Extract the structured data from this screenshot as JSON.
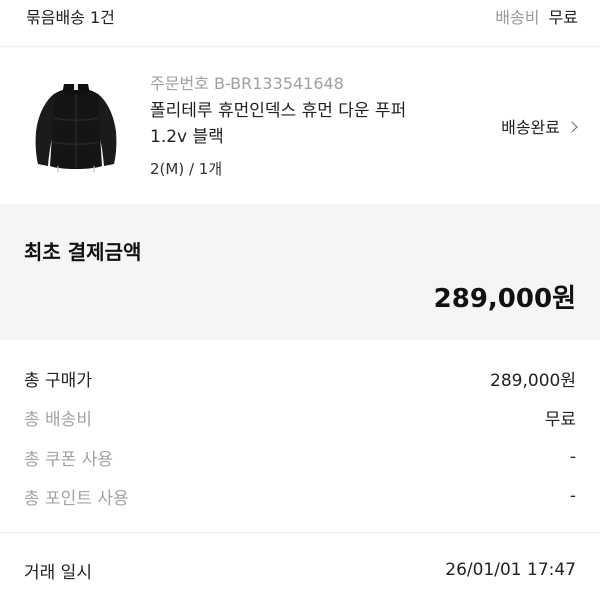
{
  "bundle": {
    "title": "묶음배송 1건",
    "shipping_fee_label": "배송비",
    "shipping_fee_value": "무료"
  },
  "product": {
    "order_number": "주문번호 B-BR133541648",
    "name": "폴리테루 휴먼인덱스 휴먼 다운 푸퍼 1.2v 블랙",
    "option": "2(M) / 1개",
    "status": "배송완료",
    "thumb_icon": "black-puffer-jacket-image"
  },
  "payment": {
    "label": "최초 결제금액",
    "amount": "289,000원"
  },
  "breakdown": [
    {
      "label": "총 구매가",
      "value": "289,000원"
    },
    {
      "label": "총 배송비",
      "value": "무료"
    },
    {
      "label": "총 쿠폰 사용",
      "value": "-"
    },
    {
      "label": "총 포인트 사용",
      "value": "-"
    }
  ],
  "transaction": {
    "label": "거래 일시",
    "value": "26/01/01 17:47"
  }
}
